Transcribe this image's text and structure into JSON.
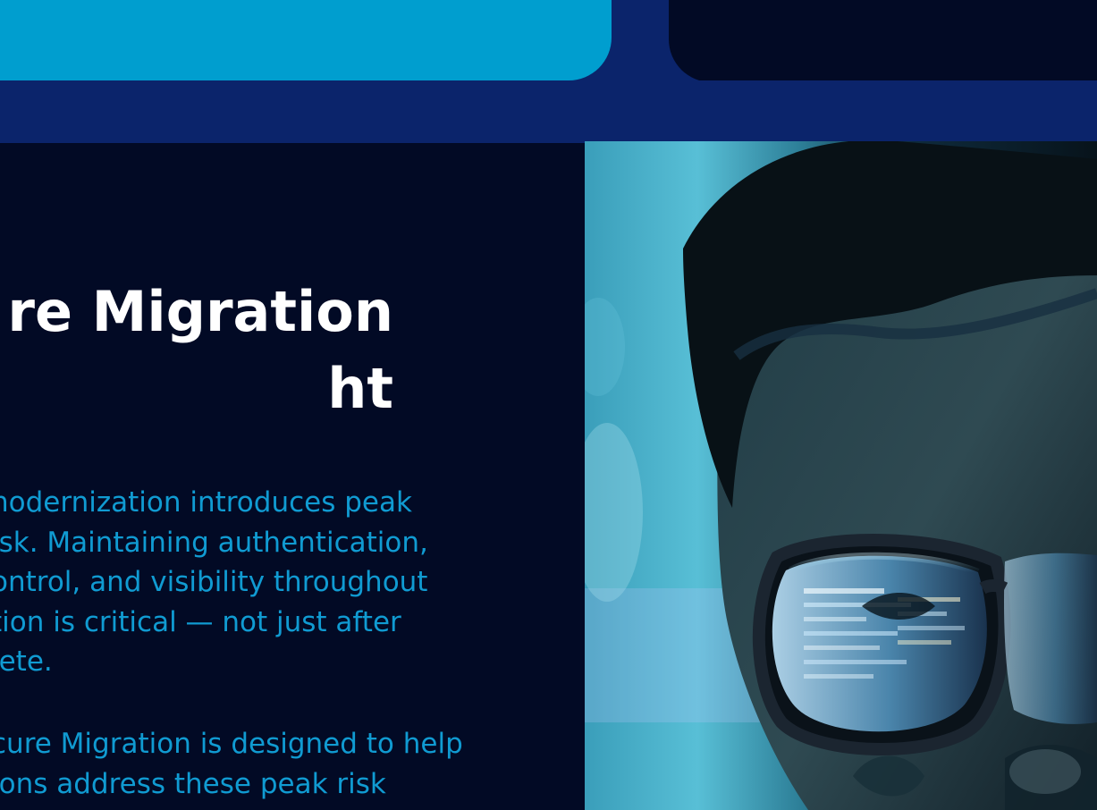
{
  "headline": "re Migration\nht",
  "paragraphs": [
    "nodernization introduces peak\nisk. Maintaining authentication,\nontrol, and visibility throughout\ntion is critical — not just after\nlete.",
    "cure Migration is designed to help\nions address these peak risk"
  ],
  "colors": {
    "page_background": "#0b246b",
    "accent_cyan": "#009ecf",
    "panel_dark": "#020a25",
    "headline_text": "#ffffff",
    "body_text": "#109bd2"
  }
}
